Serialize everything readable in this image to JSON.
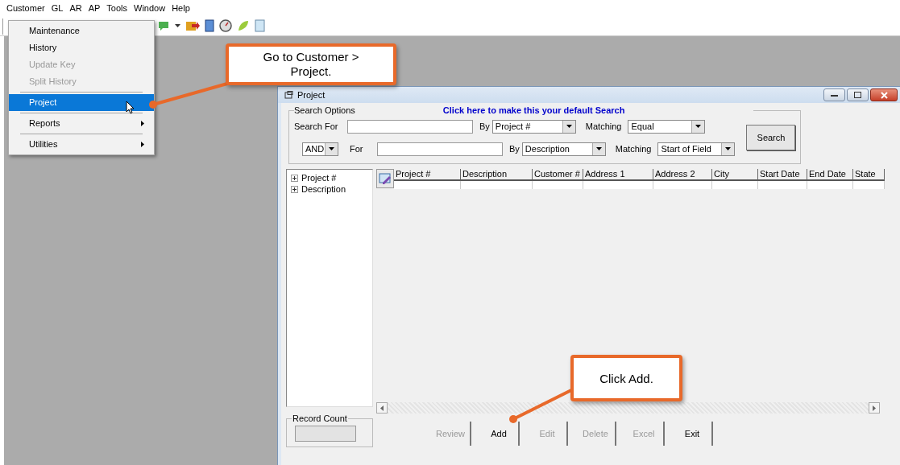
{
  "menu_bar": [
    {
      "label": "Customer"
    },
    {
      "label": "GL"
    },
    {
      "label": "AR"
    },
    {
      "label": "AP"
    },
    {
      "label": "Tools"
    },
    {
      "label": "Window"
    },
    {
      "label": "Help"
    }
  ],
  "customer_menu": [
    [
      {
        "label": "Maintenance",
        "disabled": false,
        "selected": false,
        "submenu": false
      },
      {
        "label": "History",
        "disabled": false,
        "selected": false,
        "submenu": false
      },
      {
        "label": "Update Key",
        "disabled": true,
        "selected": false,
        "submenu": false
      },
      {
        "label": "Split History",
        "disabled": true,
        "selected": false,
        "submenu": false
      }
    ],
    [
      {
        "label": "Project",
        "disabled": false,
        "selected": true,
        "submenu": false
      }
    ],
    [
      {
        "label": "Reports",
        "disabled": false,
        "selected": false,
        "submenu": true
      }
    ],
    [
      {
        "label": "Utilities",
        "disabled": false,
        "selected": false,
        "submenu": true
      }
    ]
  ],
  "callouts": [
    {
      "text": "Go to Customer > Project."
    },
    {
      "text": "Click Add."
    }
  ],
  "window": {
    "title": "Project",
    "search_options": {
      "legend": "Search Options",
      "default_link": "Click here to make this your default Search",
      "row_1": {
        "label": "Search For",
        "by_label": "By",
        "by": "Project #",
        "matching_label": "Matching",
        "matching": "Equal"
      },
      "row_2": {
        "operator": "AND",
        "label": "For",
        "by_label": "By",
        "by": "Description",
        "matching_label": "Matching",
        "matching": "Start of Field"
      },
      "search_button": "Search"
    },
    "tree": [
      {
        "label": "Project #",
        "expanded": false
      },
      {
        "label": "Description",
        "expanded": false
      }
    ],
    "grid_columns": [
      "Project #",
      "Description",
      "Customer #",
      "Address 1",
      "Address 2",
      "City",
      "Start Date",
      "End Date",
      "State"
    ],
    "record_count": {
      "label": "Record Count"
    },
    "buttons": [
      {
        "label": "Review",
        "disabled": true
      },
      {
        "label": "Add",
        "disabled": false
      },
      {
        "label": "Edit",
        "disabled": true
      },
      {
        "label": "Delete",
        "disabled": true
      },
      {
        "label": "Excel",
        "disabled": true
      },
      {
        "label": "Exit",
        "disabled": false
      }
    ]
  }
}
